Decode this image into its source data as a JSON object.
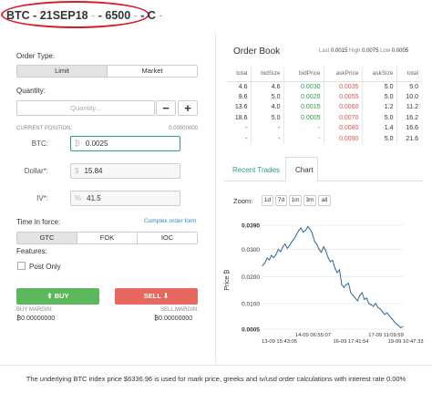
{
  "title": {
    "asset": "BTC - 21SEP18",
    "sep1": " - ",
    "strike": "- 6500",
    "sep2": " - ",
    "type": "- C",
    "sep3": " -"
  },
  "order_type": {
    "label": "Order Type:",
    "options": [
      "Limit",
      "Market"
    ],
    "selected": "Limit"
  },
  "quantity": {
    "label": "Quantity:",
    "placeholder": "Quantity...",
    "minus": "−",
    "plus": "+"
  },
  "current_position": {
    "label": "CURRENT POSITION:",
    "value": "0.00000000"
  },
  "btc": {
    "label": "BTC:",
    "symbol": "₿",
    "value": "0.0025"
  },
  "dollar": {
    "label": "Dollar*:",
    "symbol": "$",
    "value": "15.84"
  },
  "iv": {
    "label": "IV*:",
    "symbol": "%",
    "value": "41.5"
  },
  "time_in_force": {
    "label": "Time in force:",
    "link": "Complex order form",
    "options": [
      "GTC",
      "FOK",
      "IOC"
    ],
    "selected": "GTC"
  },
  "features": {
    "label": "Features:",
    "post_only": "Post Only"
  },
  "buy": {
    "label": "⬆ BUY",
    "margin_label": "BUY MARGIN:",
    "margin_value": "₿0.00000000"
  },
  "sell": {
    "label": "SELL ⬇",
    "margin_label": "SELL MARGIN:",
    "margin_value": "₿0.00000000"
  },
  "order_book": {
    "title": "Order Book",
    "last_label": "Last",
    "last": "0.0015",
    "high_label": "High",
    "high": "0.0075",
    "low_label": "Low",
    "low": "0.0005",
    "columns": [
      "total",
      "bidSize",
      "bidPrice",
      "askPrice",
      "askSize",
      "total"
    ],
    "rows": [
      [
        "4.6",
        "4.6",
        "0.0030",
        "0.0035",
        "5.0",
        "5.0"
      ],
      [
        "9.6",
        "5.0",
        "0.0020",
        "0.0055",
        "5.0",
        "10.0"
      ],
      [
        "13.6",
        "4.0",
        "0.0015",
        "0.0060",
        "1.2",
        "11.2"
      ],
      [
        "18.6",
        "5.0",
        "0.0005",
        "0.0070",
        "5.0",
        "16.2"
      ],
      [
        "-",
        "-",
        "-",
        "0.0080",
        "1.4",
        "16.6"
      ],
      [
        "-",
        "-",
        "-",
        "0.0090",
        "5.0",
        "21.6"
      ]
    ]
  },
  "tabs": [
    "Recent Trades",
    "Chart"
  ],
  "zoom": {
    "label": "Zoom:",
    "options": [
      "1d",
      "7d",
      "1m",
      "3m",
      "all"
    ]
  },
  "chart_data": {
    "type": "line",
    "ylabel": "Price ₿",
    "ylim": [
      0.0005,
      0.039
    ],
    "y_ticks": [
      "0.0390",
      "0.0300",
      "0.0200",
      "0.0100",
      "0.0005"
    ],
    "x_ticks_top": [
      "14-09 06:55:07",
      "17-09 11:09:59"
    ],
    "x_ticks_bottom": [
      "13-09 15:43:05",
      "16-09 17:41:54",
      "19-09 10:47:33"
    ],
    "x": [
      0,
      1,
      2,
      3,
      4,
      5,
      6,
      7,
      8,
      9,
      10,
      11,
      12,
      13,
      14,
      15,
      16,
      17,
      18,
      19,
      20,
      21,
      22,
      23,
      24,
      25,
      26,
      27,
      28,
      29,
      30,
      31,
      32,
      33,
      34,
      35,
      36,
      37,
      38,
      39,
      40,
      41,
      42,
      43,
      44,
      45,
      46,
      47,
      48,
      49,
      50,
      51,
      52,
      53,
      54,
      55,
      56,
      57,
      58,
      59,
      60,
      61,
      62
    ],
    "values": [
      0.024,
      0.025,
      0.0268,
      0.0262,
      0.0278,
      0.027,
      0.0282,
      0.03,
      0.0292,
      0.031,
      0.032,
      0.0305,
      0.0315,
      0.033,
      0.034,
      0.0355,
      0.037,
      0.038,
      0.0365,
      0.037,
      0.0385,
      0.0375,
      0.036,
      0.033,
      0.032,
      0.03,
      0.029,
      0.031,
      0.0295,
      0.027,
      0.0255,
      0.026,
      0.023,
      0.0215,
      0.0225,
      0.017,
      0.016,
      0.017,
      0.0175,
      0.014,
      0.013,
      0.012,
      0.011,
      0.013,
      0.014,
      0.0115,
      0.012,
      0.01,
      0.0095,
      0.009,
      0.01,
      0.0085,
      0.008,
      0.007,
      0.006,
      0.0065,
      0.0055,
      0.0045,
      0.0035,
      0.0025,
      0.002,
      0.001,
      0.0015
    ],
    "color": "#2f6a9b"
  },
  "footer": "The underlying BTC index price $6336.96 is used for mark price, greeks and iv/usd order calculations with interest rate 0.00%"
}
